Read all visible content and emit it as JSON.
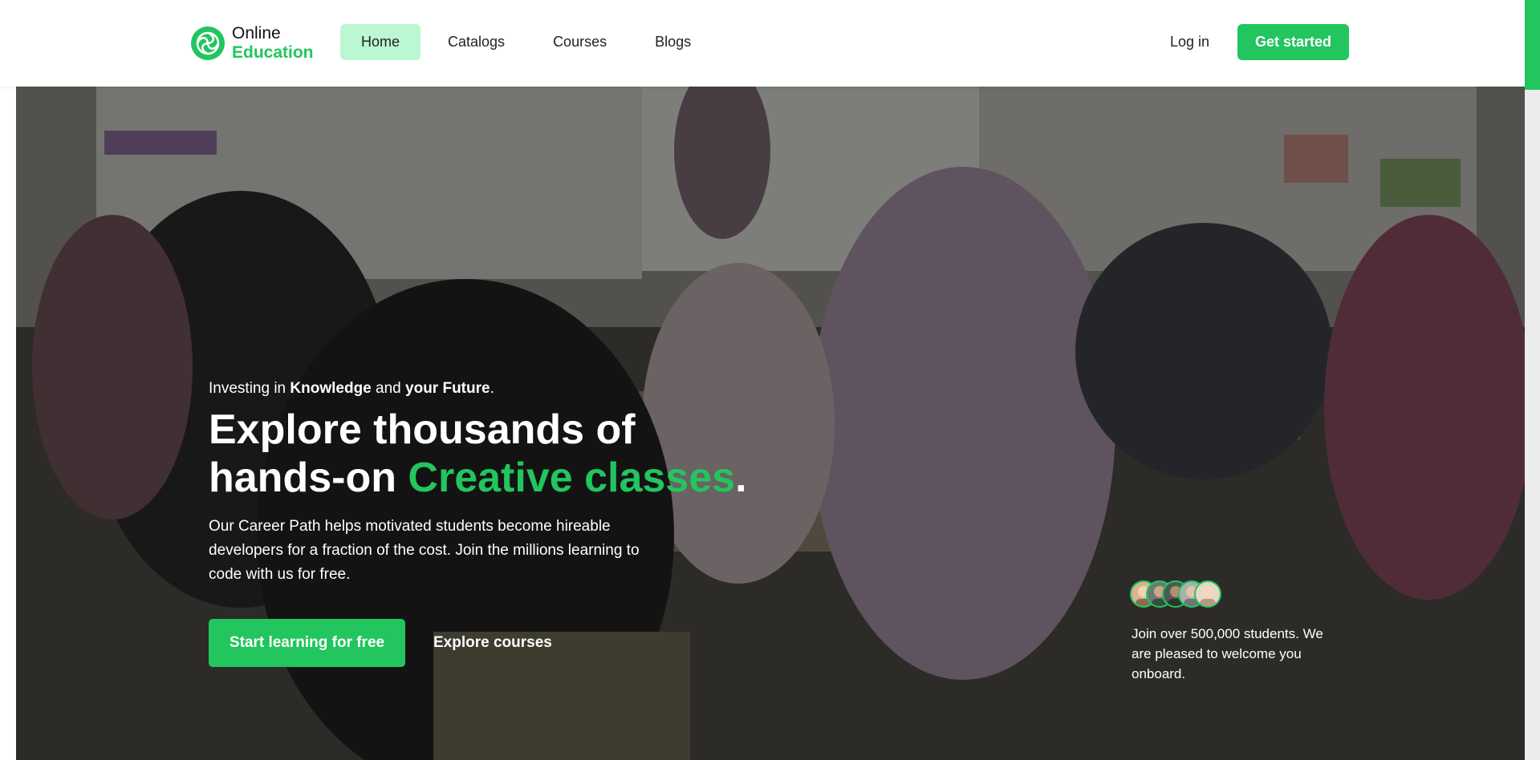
{
  "brand": {
    "name_line1": "Online",
    "name_line2": "Education"
  },
  "nav": {
    "items": [
      {
        "label": "Home",
        "active": true
      },
      {
        "label": "Catalogs",
        "active": false
      },
      {
        "label": "Courses",
        "active": false
      },
      {
        "label": "Blogs",
        "active": false
      }
    ],
    "login_label": "Log in",
    "get_started_label": "Get started"
  },
  "hero": {
    "tagline": {
      "prefix": "Investing in ",
      "strong1": "Knowledge",
      "middle": " and ",
      "strong2": "your Future",
      "suffix": "."
    },
    "headline": {
      "line1": "Explore thousands of",
      "line2_prefix": "hands-on ",
      "accent": "Creative classes",
      "suffix": "."
    },
    "description": "Our Career Path helps motivated students become hireable developers for a fraction of the cost. Join the millions learning to code with us for free.",
    "cta_primary": "Start learning for free",
    "cta_secondary": "Explore courses",
    "social_proof": "Join over 500,000 students. We are pleased to welcome you onboard."
  },
  "colors": {
    "accent": "#22c55e",
    "accent_light": "#bbf7d0",
    "text_dark": "#222222",
    "overlay": "rgba(0,0,0,0.42)"
  },
  "icons": [
    "logo-swirl-icon",
    "student-avatar"
  ]
}
